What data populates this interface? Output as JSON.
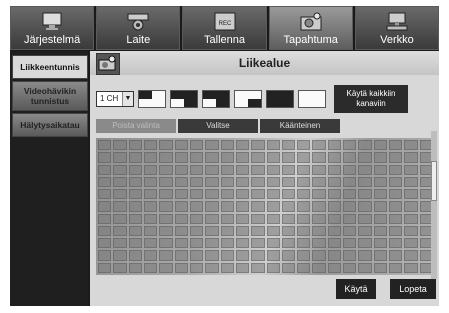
{
  "tabs": [
    {
      "label": "Järjestelmä",
      "icon": "monitor-icon"
    },
    {
      "label": "Laite",
      "icon": "camera-icon"
    },
    {
      "label": "Tallenna",
      "icon": "rec-icon"
    },
    {
      "label": "Tapahtuma",
      "icon": "event-camera-icon"
    },
    {
      "label": "Verkko",
      "icon": "network-icon"
    }
  ],
  "active_tab": 3,
  "sidebar": {
    "items": [
      {
        "label": "Liikkeentunnis"
      },
      {
        "label": "Videohävikin\ntunnistus"
      },
      {
        "label": "Hälytysaikatau"
      }
    ],
    "active": 0
  },
  "panel": {
    "title": "Liikealue",
    "channel": "1 CH",
    "apply_all_label": "Käytä kaikkiin\nkanaviin",
    "clear_label": "Poista valinta",
    "select_label": "Valitse",
    "invert_label": "Käänteinen",
    "apply_label": "Käytä",
    "close_label": "Lopeta"
  },
  "grid": {
    "columns": 22,
    "rows": 11
  }
}
